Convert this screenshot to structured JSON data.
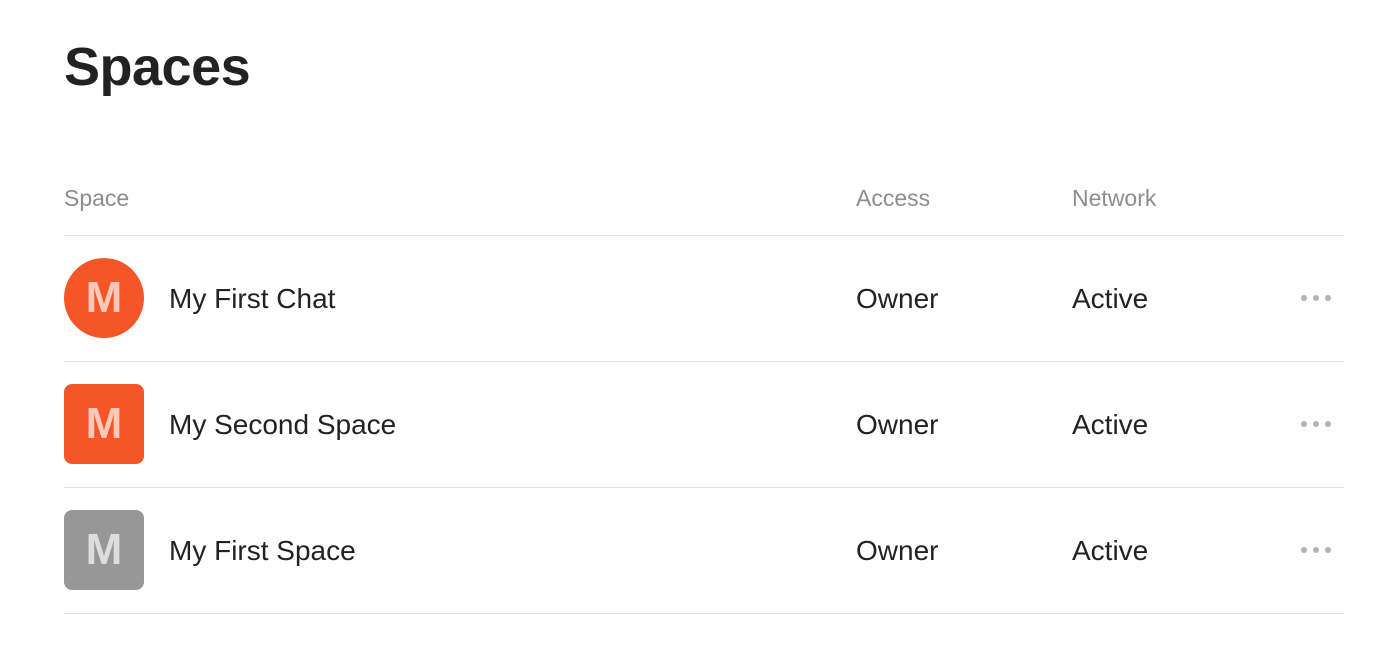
{
  "page": {
    "title": "Spaces"
  },
  "table": {
    "columns": {
      "space": "Space",
      "access": "Access",
      "network": "Network"
    },
    "rows": [
      {
        "avatar_letter": "M",
        "avatar_shape": "circle",
        "avatar_color": "#f55628",
        "name": "My First Chat",
        "access": "Owner",
        "network": "Active",
        "menu_icon": "more-horizontal-icon"
      },
      {
        "avatar_letter": "M",
        "avatar_shape": "rounded",
        "avatar_color": "#f55628",
        "name": "My Second Space",
        "access": "Owner",
        "network": "Active",
        "menu_icon": "more-horizontal-icon"
      },
      {
        "avatar_letter": "M",
        "avatar_shape": "rounded",
        "avatar_color": "#979797",
        "name": "My First Space",
        "access": "Owner",
        "network": "Active",
        "menu_icon": "more-horizontal-icon"
      }
    ]
  },
  "colors": {
    "header_text": "#8d8d8d",
    "divider": "#e3e3e3",
    "menu_dots": "#b4b4b4"
  }
}
